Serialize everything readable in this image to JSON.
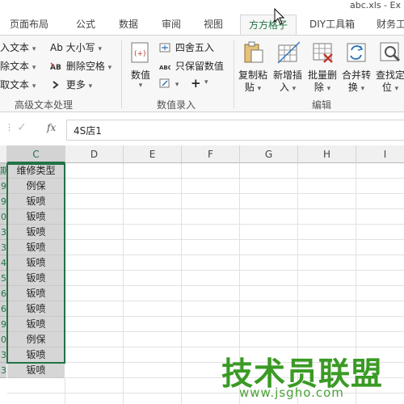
{
  "window": {
    "title": "abc.xls - Ex"
  },
  "tabs": [
    {
      "label": "页面布局"
    },
    {
      "label": "公式"
    },
    {
      "label": "数据"
    },
    {
      "label": "审阅"
    },
    {
      "label": "视图"
    },
    {
      "label": "方方格子"
    },
    {
      "label": "DIY工具箱"
    },
    {
      "label": "财务工"
    }
  ],
  "ribbon": {
    "text_group": {
      "items": [
        "入文本",
        "除文本",
        "取文本"
      ],
      "case": "Ab 大小写",
      "delete_space": "删除空格",
      "more": "更多",
      "label": "高级文本处理"
    },
    "number_group": {
      "value_btn": "数值",
      "round": "四舍五入",
      "keep_value": "只保留数值",
      "label": "数值录入"
    },
    "edit_group": {
      "buttons": [
        {
          "line1": "复制粘",
          "line2": "贴"
        },
        {
          "line1": "新增插",
          "line2": "入"
        },
        {
          "line1": "批量删",
          "line2": "除"
        },
        {
          "line1": "合并转",
          "line2": "换"
        },
        {
          "line1": "查找定",
          "line2": "位"
        }
      ],
      "label": "编辑"
    }
  },
  "formula_bar": {
    "fx": "fx",
    "value": "4S店1"
  },
  "grid": {
    "columns": [
      "C",
      "D",
      "E",
      "F",
      "G",
      "H",
      "I"
    ],
    "row_numbers": [
      "期",
      "9",
      "9",
      "0",
      "3",
      "3",
      "4",
      "5",
      "6",
      "6",
      "9",
      "0",
      "3",
      "3"
    ],
    "column_c": [
      "维修类型",
      "例保",
      "钣喷",
      "钣喷",
      "钣喷",
      "钣喷",
      "钣喷",
      "钣喷",
      "钣喷",
      "钣喷",
      "钣喷",
      "例保",
      "钣喷",
      "钣喷"
    ]
  },
  "watermark": {
    "main": "技术员联盟",
    "url": "www.jsgho.com"
  },
  "colors": {
    "accent": "#217346",
    "selection_fill": "#d6d6d6",
    "watermark": "#3a9a24"
  }
}
